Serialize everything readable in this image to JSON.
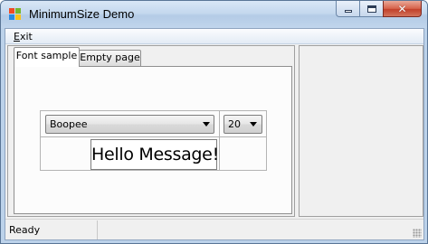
{
  "window": {
    "title": "MinimumSize Demo",
    "icon": "app-windows-icon",
    "buttons": {
      "minimize": "minimize-icon",
      "maximize": "maximize-icon",
      "close": "close-icon"
    }
  },
  "menu": {
    "items": [
      {
        "label_mnemonic": "E",
        "label_rest": "xit"
      }
    ]
  },
  "tabs": [
    {
      "label": "Font sample",
      "selected": true
    },
    {
      "label": "Empty page",
      "selected": false
    }
  ],
  "font_sample": {
    "font_name": "Boopee",
    "font_size": "20",
    "sample_text": "Hello Message!"
  },
  "status": {
    "text": "Ready"
  },
  "colors": {
    "titlebar": "#c4d8ee",
    "close_button": "#d7634b",
    "client_background": "#f0f0f0"
  }
}
